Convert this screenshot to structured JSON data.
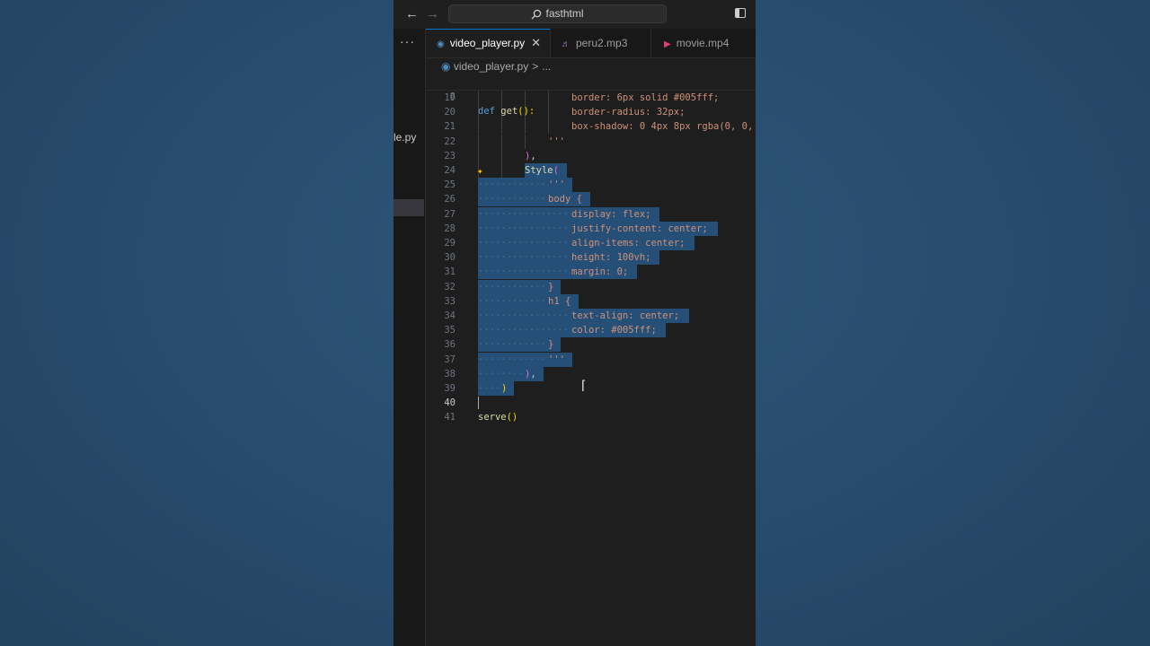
{
  "titlebar": {
    "back_icon": "arrow-left-icon",
    "forward_icon": "arrow-right-icon",
    "search_text": "fasthtml",
    "layout_icon": "toggle-sidebar-icon"
  },
  "sidebar": {
    "more_label": "···",
    "file_label": "le.py"
  },
  "tabs": [
    {
      "label": "video_player.py",
      "icon": "python-file-icon",
      "active": true
    },
    {
      "label": "peru2.mp3",
      "icon": "audio-file-icon",
      "active": false
    },
    {
      "label": "movie.mp4",
      "icon": "video-file-icon",
      "active": false
    }
  ],
  "tab_close": "✕",
  "breadcrumb": {
    "file": "video_player.py",
    "separator": ">",
    "more": "..."
  },
  "sticky": {
    "number": "8",
    "kw": "def",
    "fn": "get",
    "rest": "():"
  },
  "lines": [
    {
      "n": "19",
      "indent": 4,
      "text": "border: 6px solid #005fff;"
    },
    {
      "n": "20",
      "indent": 4,
      "text": "border-radius: 32px;"
    },
    {
      "n": "21",
      "indent": 4,
      "text": "box-shadow: 0 4px 8px rgba(0, 0,"
    },
    {
      "n": "22",
      "indent": 3,
      "text": "'''"
    },
    {
      "n": "23",
      "indent": 2,
      "text": "),"
    },
    {
      "n": "24",
      "indent": 2,
      "text": "Style("
    },
    {
      "n": "25",
      "indent": 3,
      "text": "'''"
    },
    {
      "n": "26",
      "indent": 3,
      "text": "body {"
    },
    {
      "n": "27",
      "indent": 4,
      "text": "display: flex;"
    },
    {
      "n": "28",
      "indent": 4,
      "text": "justify-content: center;"
    },
    {
      "n": "29",
      "indent": 4,
      "text": "align-items: center;"
    },
    {
      "n": "30",
      "indent": 4,
      "text": "height: 100vh;"
    },
    {
      "n": "31",
      "indent": 4,
      "text": "margin: 0;"
    },
    {
      "n": "32",
      "indent": 3,
      "text": "}"
    },
    {
      "n": "33",
      "indent": 3,
      "text": "h1 {"
    },
    {
      "n": "34",
      "indent": 4,
      "text": "text-align: center;"
    },
    {
      "n": "35",
      "indent": 4,
      "text": "color: #005fff;"
    },
    {
      "n": "36",
      "indent": 3,
      "text": "}"
    },
    {
      "n": "37",
      "indent": 3,
      "text": "'''"
    },
    {
      "n": "38",
      "indent": 2,
      "text": "),"
    },
    {
      "n": "39",
      "indent": 1,
      "text": ")"
    },
    {
      "n": "40",
      "indent": 0,
      "text": ""
    },
    {
      "n": "41",
      "indent": 0,
      "text": "serve()"
    }
  ],
  "colors": {
    "background": "#284d6f",
    "editor": "#1e1e1e",
    "selection": "#264f78",
    "string": "#ce9178",
    "keyword": "#569cd6",
    "function": "#dcdcaa"
  }
}
